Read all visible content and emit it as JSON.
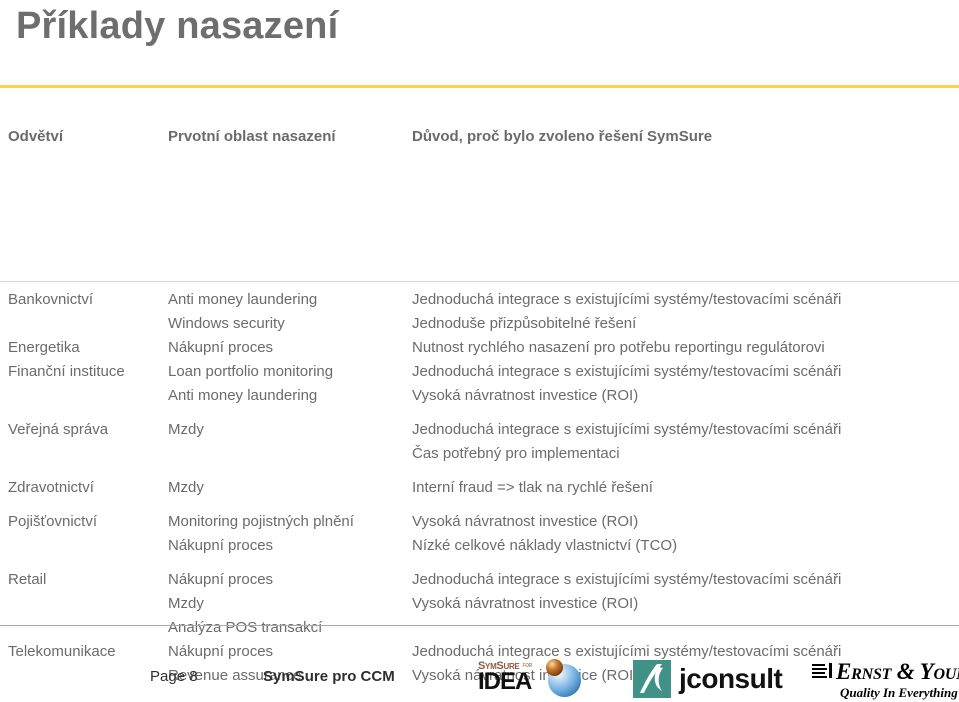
{
  "slide": {
    "title": "Příklady nasazení",
    "accent_color": "#ffd24d",
    "text_color": "#6b6b6b"
  },
  "table": {
    "headers": {
      "industry": "Odvětví",
      "area": "Prvotní oblast nasazení",
      "reason": "Důvod, proč bylo zvoleno řešení SymSure"
    },
    "rows": [
      {
        "industry": "Bankovnictví",
        "lines": [
          {
            "area": "Anti money laundering",
            "reason": "Jednoduchá integrace s existujícími systémy/testovacími scénáři"
          },
          {
            "area": "Windows security",
            "reason": "Jednoduše přizpůsobitelné řešení"
          }
        ]
      },
      {
        "industry": "Energetika",
        "lines": [
          {
            "area": "Nákupní proces",
            "reason": "Nutnost rychlého nasazení pro potřebu reportingu regulátorovi"
          }
        ]
      },
      {
        "industry": "Finanční instituce",
        "lines": [
          {
            "area": "Loan portfolio monitoring",
            "reason": "Jednoduchá integrace s existujícími systémy/testovacími scénáři"
          },
          {
            "area": "Anti money laundering",
            "reason": "Vysoká návratnost investice (ROI)"
          }
        ]
      },
      {
        "industry": "Veřejná správa",
        "lines": [
          {
            "area": "Mzdy",
            "reason": "Jednoduchá integrace s existujícími systémy/testovacími scénáři"
          },
          {
            "area": "",
            "reason": "Čas potřebný pro implementaci"
          }
        ]
      },
      {
        "industry": "Zdravotnictví",
        "lines": [
          {
            "area": "Mzdy",
            "reason": "Interní fraud => tlak na rychlé řešení"
          }
        ]
      },
      {
        "industry": "Pojišťovnictví",
        "lines": [
          {
            "area": "Monitoring pojistných plnění",
            "reason": "Vysoká návratnost investice (ROI)"
          },
          {
            "area": "Nákupní proces",
            "reason": "Nízké celkové náklady vlastnictví (TCO)"
          }
        ]
      },
      {
        "industry": "Retail",
        "lines": [
          {
            "area": "Nákupní proces",
            "reason": "Jednoduchá integrace s existujícími systémy/testovacími scénáři"
          },
          {
            "area": "Mzdy",
            "reason": "Vysoká návratnost investice (ROI)"
          },
          {
            "area": "Analýza POS transakcí",
            "reason": ""
          }
        ]
      },
      {
        "industry": "Telekomunikace",
        "lines": [
          {
            "area": "Nákupní proces",
            "reason": "Jednoduchá integrace s existujícími systémy/testovacími scénáři"
          },
          {
            "area": "Revenue assurance",
            "reason": "Vysoká návratnost investice (ROI)"
          }
        ]
      }
    ]
  },
  "footer": {
    "page_label": "Page 8",
    "deck_label": "SymSure pro CCM",
    "logos": {
      "symsure": {
        "top_text": "SymSure",
        "for_text": "for",
        "main_text": "IDEA",
        "accent_color": "#8d5a3b"
      },
      "jconsult": {
        "word": "jconsult",
        "square_color": "#3f9285"
      },
      "ey": {
        "name": "Ernst & Young",
        "tagline": "Quality In Everything We Do"
      }
    }
  }
}
